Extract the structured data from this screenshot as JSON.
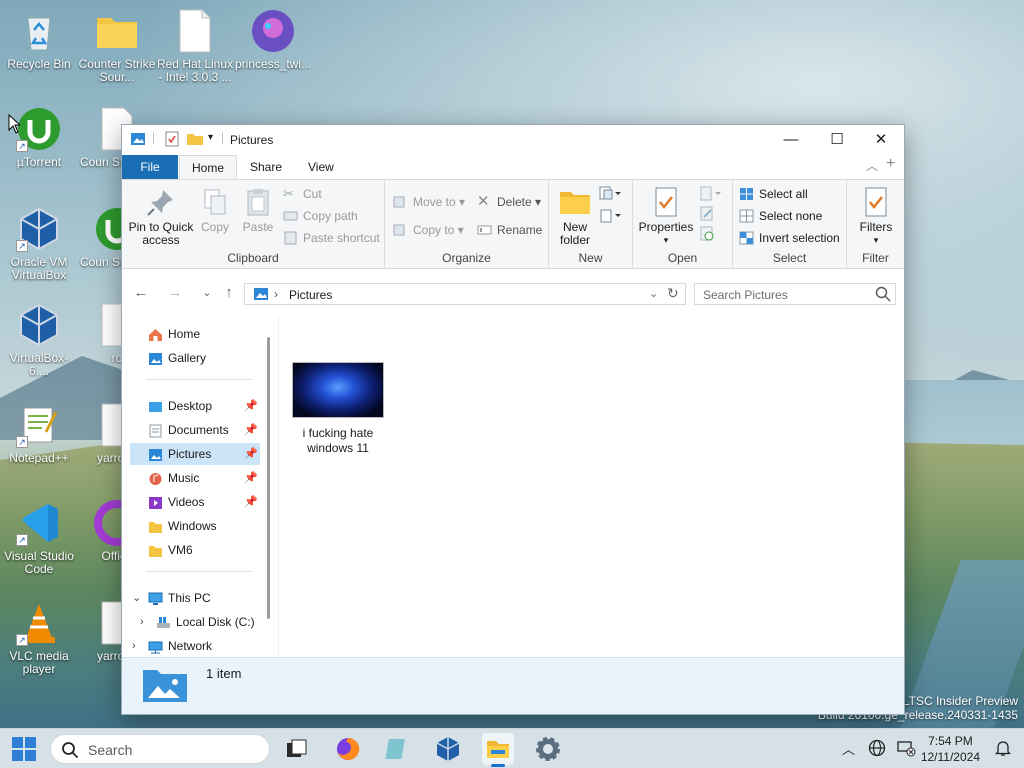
{
  "desktop": {
    "icons": [
      {
        "label": "Recycle Bin"
      },
      {
        "label": "Counter Strike Sour..."
      },
      {
        "label": "Red Hat Linux - Intel 3.0.3 ..."
      },
      {
        "label": "princess_twi..."
      },
      {
        "label": "µTorrent"
      },
      {
        "label": "Coun Strike S"
      },
      {
        "label": "Oracle VM VirtualBox"
      },
      {
        "label": "Coun Strike S"
      },
      {
        "label": "VirtualBox-6...."
      },
      {
        "label": "ro"
      },
      {
        "label": "Notepad++"
      },
      {
        "label": "yarrow-"
      },
      {
        "label": "Visual Studio Code"
      },
      {
        "label": "Office"
      },
      {
        "label": "VLC media player"
      },
      {
        "label": "yarrow-"
      }
    ],
    "watermark_line1": "e LTSC Insider Preview",
    "watermark_line2": "Build 26100.ge_release.240331-1435"
  },
  "window": {
    "title": "Pictures",
    "tabs": {
      "file": "File",
      "home": "Home",
      "share": "Share",
      "view": "View"
    },
    "ribbon": {
      "clipboard": {
        "pin": "Pin to Quick access",
        "copy": "Copy",
        "paste": "Paste",
        "cut": "Cut",
        "copy_path": "Copy path",
        "paste_shortcut": "Paste shortcut",
        "group": "Clipboard"
      },
      "organize": {
        "move_to": "Move to",
        "copy_to": "Copy to",
        "delete": "Delete",
        "rename": "Rename",
        "group": "Organize"
      },
      "new": {
        "new_folder": "New folder",
        "group": "New"
      },
      "open": {
        "properties": "Properties",
        "group": "Open"
      },
      "select": {
        "select_all": "Select all",
        "select_none": "Select none",
        "invert": "Invert selection",
        "group": "Select"
      },
      "filter": {
        "filters": "Filters",
        "group": "Filter"
      }
    },
    "address": {
      "crumb": "Pictures",
      "search_placeholder": "Search Pictures"
    },
    "nav": {
      "home": "Home",
      "gallery": "Gallery",
      "desktop": "Desktop",
      "documents": "Documents",
      "pictures": "Pictures",
      "music": "Music",
      "videos": "Videos",
      "windows": "Windows",
      "vm6": "VM6",
      "this_pc": "This PC",
      "local_disk": "Local Disk (C:)",
      "network": "Network"
    },
    "files": [
      {
        "name": "i fucking hate windows 11"
      }
    ],
    "status": "1 item"
  },
  "taskbar": {
    "search_placeholder": "Search",
    "time": "7:54 PM",
    "date": "12/11/2024"
  },
  "colors": {
    "accent": "#1a6fb4",
    "selection": "#cce4f7"
  }
}
